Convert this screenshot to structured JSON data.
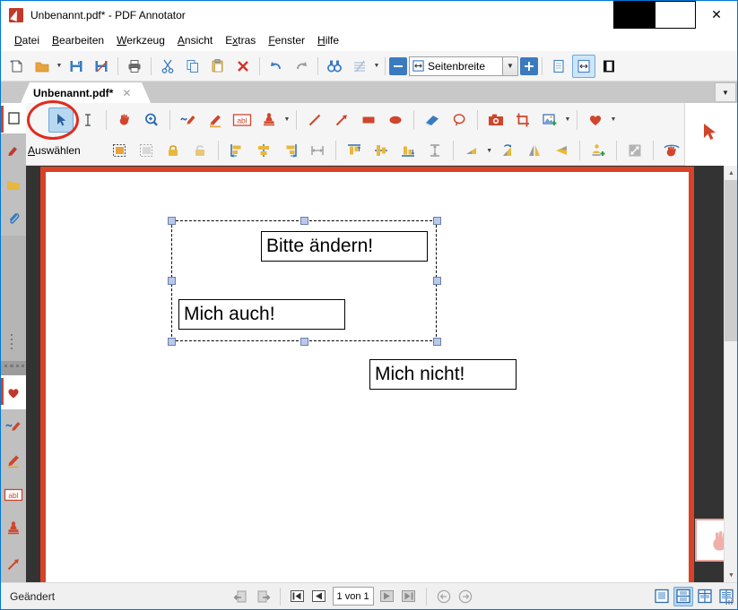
{
  "window": {
    "title": "Unbenannt.pdf* - PDF Annotator",
    "logo_icon": "pdf-annotator-logo-icon",
    "minimize_label": "–",
    "maximize_label": "□",
    "close_label": "✕"
  },
  "menubar": {
    "items": [
      {
        "label": "Datei",
        "accel": "D"
      },
      {
        "label": "Bearbeiten",
        "accel": "B"
      },
      {
        "label": "Werkzeug",
        "accel": "W"
      },
      {
        "label": "Ansicht",
        "accel": "A"
      },
      {
        "label": "Extras",
        "accel": "x"
      },
      {
        "label": "Fenster",
        "accel": "F"
      },
      {
        "label": "Hilfe",
        "accel": "H"
      }
    ]
  },
  "main_toolbar": {
    "buttons": [
      {
        "name": "new-document-icon",
        "title": "Neu"
      },
      {
        "name": "open-folder-icon",
        "title": "Öffnen"
      },
      {
        "name": "open-dropdown-caret-icon",
        "title": "Zuletzt geöffnet"
      },
      {
        "name": "save-icon",
        "title": "Speichern"
      },
      {
        "name": "save-as-icon",
        "title": "Speichern unter"
      },
      {
        "name": "print-icon",
        "title": "Drucken"
      },
      {
        "name": "cut-scissors-icon",
        "title": "Ausschneiden"
      },
      {
        "name": "copy-icon",
        "title": "Kopieren"
      },
      {
        "name": "paste-icon",
        "title": "Einfügen"
      },
      {
        "name": "delete-x-icon",
        "title": "Löschen"
      },
      {
        "name": "undo-icon",
        "title": "Rückgängig"
      },
      {
        "name": "redo-icon",
        "title": "Wiederholen"
      },
      {
        "name": "find-binoculars-icon",
        "title": "Suchen"
      },
      {
        "name": "grid-lines-icon",
        "title": "Linien"
      },
      {
        "name": "grid-dropdown-caret-icon",
        "title": "Linien auswählen"
      }
    ],
    "zoom": {
      "minus_label": "−",
      "plus_label": "+",
      "value": "Seitenbreite",
      "dropdown_caret": "⌵",
      "fit_icon": "fit-page-width-icon"
    },
    "view_modes": [
      {
        "name": "single-page-view-icon",
        "active": false
      },
      {
        "name": "page-width-view-icon",
        "active": true
      },
      {
        "name": "full-screen-view-icon",
        "active": false
      }
    ]
  },
  "tabstrip": {
    "tab_label": "Unbenannt.pdf*",
    "close_label": "✕",
    "overflow_caret": "▼"
  },
  "annotation_toolbar": {
    "row1": [
      {
        "name": "empty-square-icon",
        "selected": false
      },
      {
        "name": "select-arrow-icon",
        "selected": true
      },
      {
        "name": "text-cursor-icon",
        "selected": false
      },
      {
        "name": "pan-hand-icon",
        "selected": false
      },
      {
        "name": "zoom-magnifier-icon",
        "selected": false
      },
      {
        "name": "freehand-pen-icon",
        "selected": false
      },
      {
        "name": "highlighter-pen-icon",
        "selected": false
      },
      {
        "name": "text-abl-icon",
        "selected": false
      },
      {
        "name": "stamp-icon",
        "selected": false
      },
      {
        "name": "stamp-dropdown-caret-icon",
        "selected": false
      },
      {
        "name": "line-icon",
        "selected": false
      },
      {
        "name": "arrow-icon",
        "selected": false
      },
      {
        "name": "rectangle-icon",
        "selected": false
      },
      {
        "name": "ellipse-icon",
        "selected": false
      },
      {
        "name": "eraser-icon",
        "selected": false
      },
      {
        "name": "lasso-icon",
        "selected": false
      },
      {
        "name": "camera-snapshot-icon",
        "selected": false
      },
      {
        "name": "crop-icon",
        "selected": false
      },
      {
        "name": "insert-image-icon",
        "selected": false
      },
      {
        "name": "image-dropdown-caret-icon",
        "selected": false
      },
      {
        "name": "favorite-heart-icon",
        "selected": false
      },
      {
        "name": "favorite-dropdown-caret-icon",
        "selected": false
      }
    ],
    "row2_label": "Auswählen",
    "row2_accel": "A",
    "row2": [
      {
        "name": "select-all-objects-icon"
      },
      {
        "name": "deselect-objects-icon"
      },
      {
        "name": "lock-closed-icon"
      },
      {
        "name": "lock-open-icon"
      },
      {
        "name": "align-left-icon"
      },
      {
        "name": "align-center-horizontal-icon"
      },
      {
        "name": "align-right-icon"
      },
      {
        "name": "distribute-horizontal-icon"
      },
      {
        "name": "align-top-icon"
      },
      {
        "name": "align-middle-vertical-icon"
      },
      {
        "name": "align-bottom-icon"
      },
      {
        "name": "distribute-vertical-icon"
      },
      {
        "name": "rotate-shape-icon"
      },
      {
        "name": "rotate-dropdown-caret-icon"
      },
      {
        "name": "rotate-right-icon"
      },
      {
        "name": "flip-horizontal-icon"
      },
      {
        "name": "flip-vertical-icon"
      },
      {
        "name": "bring-to-front-icon"
      },
      {
        "name": "resize-diagonal-icon"
      },
      {
        "name": "hand-stamp-icon"
      }
    ]
  },
  "left_sidebar": {
    "tabs": [
      {
        "name": "sidebar-tab-pages",
        "icon": "page-thumbnail-icon",
        "active": true
      },
      {
        "name": "sidebar-tab-bookmarks",
        "icon": "bookmark-ribbon-icon",
        "active": false
      },
      {
        "name": "sidebar-tab-folder",
        "icon": "folder-icon",
        "active": false
      },
      {
        "name": "sidebar-tab-attachments",
        "icon": "paperclip-icon",
        "active": false
      },
      {
        "name": "sidebar-tab-favorites",
        "icon": "heart-icon",
        "active": true
      },
      {
        "name": "sidebar-tab-pen",
        "icon": "freehand-pen-icon",
        "active": false
      },
      {
        "name": "sidebar-tab-highlighter",
        "icon": "highlighter-pen-icon",
        "active": false
      },
      {
        "name": "sidebar-tab-text",
        "icon": "text-abl-icon",
        "active": false
      },
      {
        "name": "sidebar-tab-stamp",
        "icon": "stamp-icon",
        "active": false
      },
      {
        "name": "sidebar-tab-arrow",
        "icon": "arrow-icon",
        "active": false
      }
    ]
  },
  "document": {
    "cursor_icon": "red-arrow-cursor-icon",
    "selection": {
      "name": "multi-object-selection",
      "handles": 8
    },
    "text_boxes": [
      {
        "name": "textbox-bitte-aendern",
        "text": "Bitte ändern!",
        "selected": true
      },
      {
        "name": "textbox-mich-auch",
        "text": "Mich auch!",
        "selected": true
      },
      {
        "name": "textbox-mich-nicht",
        "text": "Mich nicht!",
        "selected": false
      }
    ],
    "hand_stamp": {
      "name": "hand-stamp-annotation",
      "icon": "hand-icon"
    }
  },
  "scrollbar": {
    "up_arrow": "▲",
    "down_arrow": "▼"
  },
  "statusbar": {
    "status_text": "Geändert",
    "nav_buttons": [
      {
        "name": "go-back-page-icon"
      },
      {
        "name": "go-forward-page-icon"
      },
      {
        "name": "first-page-icon"
      },
      {
        "name": "previous-page-icon"
      }
    ],
    "page_value": "1 von 1",
    "nav_buttons_right": [
      {
        "name": "next-page-icon"
      },
      {
        "name": "last-page-icon"
      },
      {
        "name": "history-back-icon"
      },
      {
        "name": "history-forward-icon"
      }
    ],
    "layout_buttons": [
      {
        "name": "layout-single-page-icon",
        "active": false
      },
      {
        "name": "layout-continuous-icon",
        "active": true
      },
      {
        "name": "layout-two-page-icon",
        "active": false
      },
      {
        "name": "layout-grid-icon",
        "active": false
      }
    ],
    "resize_grip": "resize-grip-icon"
  },
  "colors": {
    "accent": "#0078d7",
    "annotation_red": "#e02b20",
    "page_border_red": "#d84327",
    "toolbar_bg": "#f5f5f5",
    "selection_handle": "#b9c9ea"
  }
}
